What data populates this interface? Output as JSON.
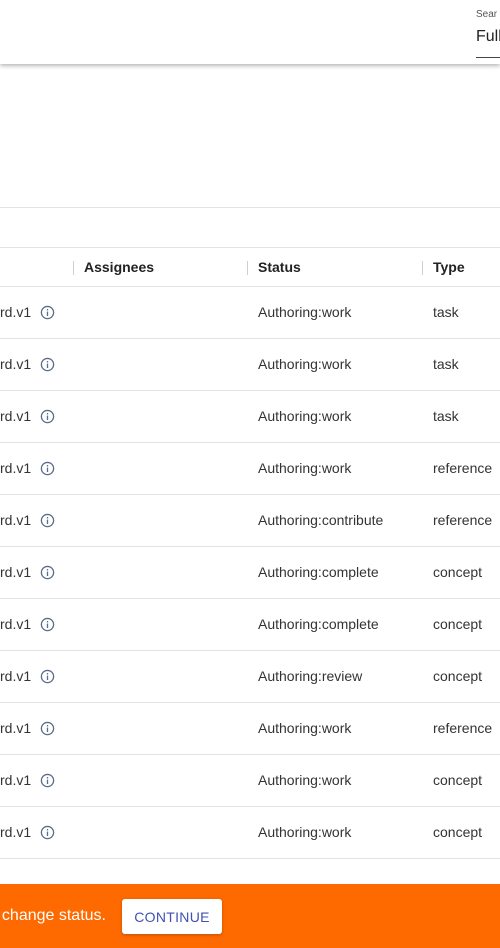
{
  "search": {
    "label": "Sear",
    "value": "Full"
  },
  "table": {
    "headers": {
      "assignees": "Assignees",
      "status": "Status",
      "type": "Type"
    },
    "rows": [
      {
        "id_fragment": "rd.v1",
        "assignees": "",
        "status": "Authoring:work",
        "type": "task"
      },
      {
        "id_fragment": "rd.v1",
        "assignees": "",
        "status": "Authoring:work",
        "type": "task"
      },
      {
        "id_fragment": "rd.v1",
        "assignees": "",
        "status": "Authoring:work",
        "type": "task"
      },
      {
        "id_fragment": "rd.v1",
        "assignees": "",
        "status": "Authoring:work",
        "type": "reference"
      },
      {
        "id_fragment": "rd.v1",
        "assignees": "",
        "status": "Authoring:contribute",
        "type": "reference"
      },
      {
        "id_fragment": "rd.v1",
        "assignees": "",
        "status": "Authoring:complete",
        "type": "concept"
      },
      {
        "id_fragment": "rd.v1",
        "assignees": "",
        "status": "Authoring:complete",
        "type": "concept"
      },
      {
        "id_fragment": "rd.v1",
        "assignees": "",
        "status": "Authoring:review",
        "type": "concept"
      },
      {
        "id_fragment": "rd.v1",
        "assignees": "",
        "status": "Authoring:work",
        "type": "reference"
      },
      {
        "id_fragment": "rd.v1",
        "assignees": "",
        "status": "Authoring:work",
        "type": "concept"
      },
      {
        "id_fragment": "rd.v1",
        "assignees": "",
        "status": "Authoring:work",
        "type": "concept"
      }
    ]
  },
  "snackbar": {
    "message": "change status.",
    "continue_label": "CONTINUE",
    "color": "#ff6a00"
  },
  "colors": {
    "accent": "#3f51b5",
    "icon": "#5a6c8a"
  }
}
